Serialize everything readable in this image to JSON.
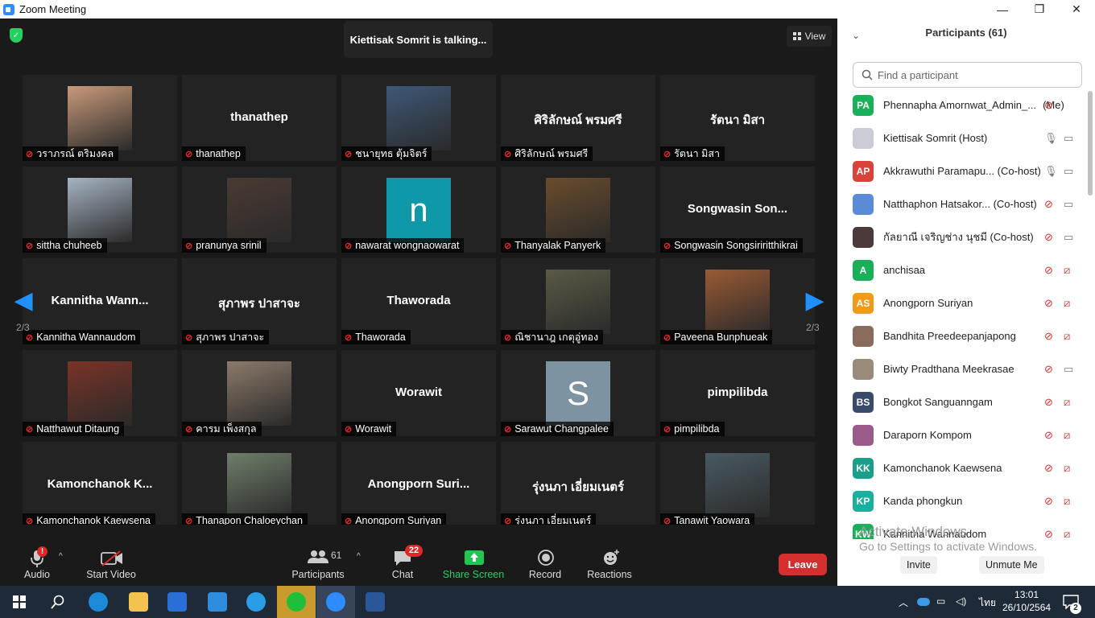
{
  "window": {
    "title": "Zoom Meeting",
    "controls": [
      "—",
      "❐",
      "✕"
    ]
  },
  "meeting": {
    "talking_indicator": "Kiettisak Somrit is talking...",
    "view_label": "View",
    "page_indicator_left": "2/3",
    "page_indicator_right": "2/3",
    "tiles": [
      {
        "big": "",
        "label": "วราภรณ์ ตริมงคล",
        "photo": "#c99a7a"
      },
      {
        "big": "thanathep",
        "label": "thanathep"
      },
      {
        "big": "",
        "label": "ชนายุทธ ตุ้มจิตร์",
        "photo": "#3e5878"
      },
      {
        "big": "ศิริลักษณ์ พรมศรี",
        "label": "ศิริลักษณ์ พรมศรี"
      },
      {
        "big": "รัตนา มิสา",
        "label": "รัตนา มิสา"
      },
      {
        "big": "",
        "label": "sittha chuheeb",
        "photo": "#a7b4c4"
      },
      {
        "big": "",
        "label": "pranunya srinil",
        "photo": "#4b3a33"
      },
      {
        "big": "",
        "label": "nawarat wongnaowarat",
        "letter": "n",
        "letter_bg": "#0e98a8"
      },
      {
        "big": "",
        "label": "Thanyalak Panyerk",
        "photo": "#6b4c2c"
      },
      {
        "big": "Songwasin  Son...",
        "label": "Songwasin Songsiriritthikrai"
      },
      {
        "big": "Kannitha  Wann...",
        "label": "Kannitha Wannaudom"
      },
      {
        "big": "สุภาพร ปาสาจะ",
        "label": "สุภาพร ปาสาจะ"
      },
      {
        "big": "Thaworada",
        "label": "Thaworada"
      },
      {
        "big": "",
        "label": "ณิชานาฎ เกตุอู่ทอง",
        "photo": "#5a5a46"
      },
      {
        "big": "",
        "label": "Paveena Bunphueak",
        "photo": "#9a5a34"
      },
      {
        "big": "",
        "label": "Natthawut Ditaung",
        "photo": "#7a3326"
      },
      {
        "big": "",
        "label": "คารม เพ็งสกุล",
        "photo": "#8c7a6a"
      },
      {
        "big": "Worawit",
        "label": "Worawit"
      },
      {
        "big": "",
        "label": "Sarawut Changpalee",
        "letter": "S",
        "letter_bg": "#7d93a1"
      },
      {
        "big": "pimpilibda",
        "label": "pimpilibda"
      },
      {
        "big": "Kamonchanok  K...",
        "label": "Kamonchanok Kaewsena"
      },
      {
        "big": "",
        "label": "Thanapon Chaloeychan",
        "photo": "#6f7e6a"
      },
      {
        "big": "Anongporn  Suri...",
        "label": "Anongporn Suriyan"
      },
      {
        "big": "รุ่งนภา เอี่ยมเนตร์",
        "label": "รุ่งนภา เอี่ยมเนตร์"
      },
      {
        "big": "",
        "label": "Tanawit Yaowara",
        "photo": "#4a5a62"
      }
    ]
  },
  "toolbar": {
    "audio": "Audio",
    "audio_alert": "!",
    "start_video": "Start Video",
    "participants": "Participants",
    "participants_count": "61",
    "chat": "Chat",
    "chat_badge": "22",
    "share_screen": "Share Screen",
    "record": "Record",
    "reactions": "Reactions",
    "leave": "Leave"
  },
  "panel": {
    "title": "Participants (61)",
    "search_placeholder": "Find a participant",
    "participants": [
      {
        "initials": "PA",
        "color": "#1ab05a",
        "name": "Phennapha Amornwat_Admin_...",
        "role": "(Me)",
        "mic": "off",
        "cam": ""
      },
      {
        "initials": "",
        "color": "#c9ccd6",
        "name": "Kiettisak Somrit (Host)",
        "role": "",
        "mic": "on",
        "cam": "on"
      },
      {
        "initials": "AP",
        "color": "#d9433a",
        "name": "Akkrawuthi Paramapu... (Co-host)",
        "role": "",
        "mic": "on",
        "cam": "on"
      },
      {
        "initials": "",
        "color": "#5b8bd6",
        "name": "Natthaphon Hatsakor... (Co-host)",
        "role": "",
        "mic": "off",
        "cam": "on"
      },
      {
        "initials": "",
        "color": "#4a3a3a",
        "name": "กัลยาณี เจริญช่าง นุชมี (Co-host)",
        "role": "",
        "mic": "off",
        "cam": "on"
      },
      {
        "initials": "A",
        "color": "#1ab05a",
        "name": "anchisaa",
        "role": "",
        "mic": "off",
        "cam": "off"
      },
      {
        "initials": "AS",
        "color": "#f09a1a",
        "name": "Anongporn Suriyan",
        "role": "",
        "mic": "off",
        "cam": "off"
      },
      {
        "initials": "",
        "color": "#8a6a5a",
        "name": "Bandhita Preedeepanjapong",
        "role": "",
        "mic": "off",
        "cam": "off"
      },
      {
        "initials": "",
        "color": "#9a8a7a",
        "name": "Biwty Pradthana Meekrasae",
        "role": "",
        "mic": "off",
        "cam": "on"
      },
      {
        "initials": "BS",
        "color": "#3a4a6a",
        "name": "Bongkot Sanguanngam",
        "role": "",
        "mic": "off",
        "cam": "off"
      },
      {
        "initials": "",
        "color": "#9a5a8a",
        "name": "Daraporn Kompom",
        "role": "",
        "mic": "off",
        "cam": "off"
      },
      {
        "initials": "KK",
        "color": "#1aa08a",
        "name": "Kamonchanok Kaewsena",
        "role": "",
        "mic": "off",
        "cam": "off"
      },
      {
        "initials": "KP",
        "color": "#1ab0a0",
        "name": "Kanda phongkun",
        "role": "",
        "mic": "off",
        "cam": "off"
      },
      {
        "initials": "KW",
        "color": "#1ab05a",
        "name": "Kannitha Wannaudom",
        "role": "",
        "mic": "off",
        "cam": "off"
      }
    ],
    "activate_title": "Activate Windows",
    "activate_sub": "Go to Settings to activate Windows.",
    "invite": "Invite",
    "unmute_me": "Unmute Me"
  },
  "taskbar": {
    "language": "ไทย",
    "time": "13:01",
    "date": "26/10/2564",
    "notification_count": "2"
  }
}
